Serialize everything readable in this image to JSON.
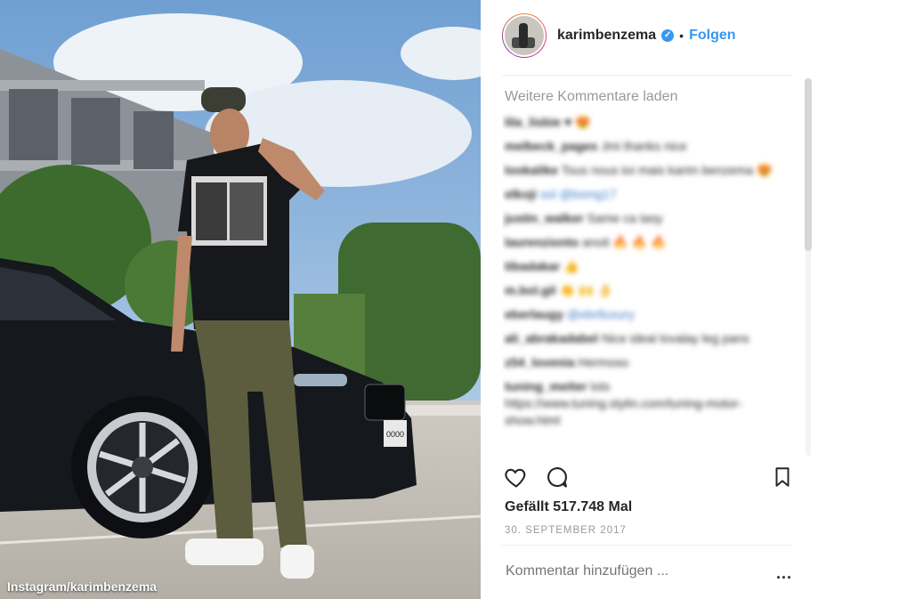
{
  "photo": {
    "credit": "Instagram/karimbenzema",
    "plate": "0000"
  },
  "header": {
    "username": "karimbenzema",
    "verified_glyph": "✓",
    "dot": "•",
    "follow_label": "Folgen",
    "avatar_icon": "profile-avatar"
  },
  "comments": {
    "load_more": "Weitere Kommentare laden",
    "items": [
      {
        "user": "lila_lisbie",
        "text": "♥ 😍"
      },
      {
        "user": "melbeck_pages",
        "text": "Jmi thanks nice"
      },
      {
        "user": "lookalike",
        "text": "Tous nous toi mais karim benzema 😍"
      },
      {
        "user": "elkoji",
        "text": "sol @bsmg17"
      },
      {
        "user": "justin_walker",
        "text": "Same ca tasy"
      },
      {
        "user": "laurenzionto",
        "text": "anoit 🔥 🔥 🔥"
      },
      {
        "user": "tibadakar",
        "text": "👍"
      },
      {
        "user": "m.bol.gil",
        "text": "👏 🙌 👌"
      },
      {
        "user": "eberlaugy",
        "text": "@ebrtluxury"
      },
      {
        "user": "ali_abrakadabel",
        "text": "Nice ideal lovalay leg pans"
      },
      {
        "user": "z54_lovenia",
        "text": "Hermoso"
      },
      {
        "user": "tuning_meiter",
        "text": "lots https://www.tuning.stylin.com/tuning-motor-show.html"
      }
    ]
  },
  "actions": {
    "like_icon": "heart-icon",
    "comment_icon": "comment-bubble-icon",
    "save_icon": "bookmark-icon"
  },
  "likes_text": "Gefällt 517.748 Mal",
  "date_text": "30. SEPTEMBER 2017",
  "add_comment": {
    "placeholder": "Kommentar hinzufügen ...",
    "more_label": "..."
  }
}
